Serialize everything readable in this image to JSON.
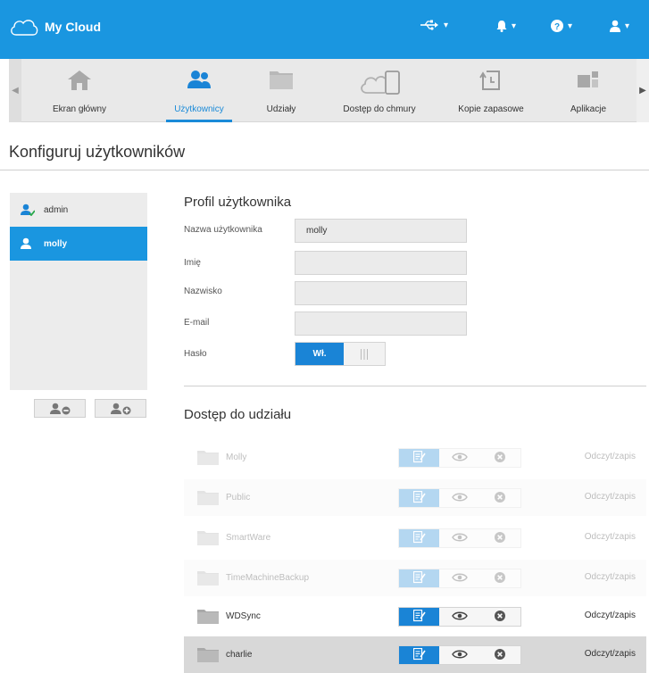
{
  "app": {
    "logo_text": "My Cloud"
  },
  "topbar": {
    "items": [
      {
        "icon": "usb-icon"
      },
      {
        "icon": "bell-icon"
      },
      {
        "icon": "help-icon"
      },
      {
        "icon": "user-icon"
      }
    ]
  },
  "nav": {
    "items": [
      {
        "label": "Ekran główny",
        "icon": "home-icon"
      },
      {
        "label": "Użytkownicy",
        "icon": "users-icon",
        "active": true
      },
      {
        "label": "Udziały",
        "icon": "folder-icon"
      },
      {
        "label": "Dostęp do chmury",
        "icon": "cloud-device-icon"
      },
      {
        "label": "Kopie zapasowe",
        "icon": "backup-icon"
      },
      {
        "label": "Aplikacje",
        "icon": "apps-icon"
      }
    ]
  },
  "page": {
    "title": "Konfiguruj użytkowników"
  },
  "users": [
    {
      "name": "admin"
    },
    {
      "name": "molly",
      "selected": true
    }
  ],
  "profile": {
    "title": "Profil użytkownika",
    "fields": {
      "username_label": "Nazwa użytkownika",
      "username_value": "molly",
      "first_name_label": "Imię",
      "first_name_value": "",
      "last_name_label": "Nazwisko",
      "last_name_value": "",
      "email_label": "E-mail",
      "email_value": "",
      "password_label": "Hasło",
      "password_toggle_on": "Wł."
    }
  },
  "shares": {
    "title": "Dostęp do udziału",
    "rows": [
      {
        "name": "Molly",
        "status": "Odczyt/zapis"
      },
      {
        "name": "Public",
        "status": "Odczyt/zapis"
      },
      {
        "name": "SmartWare",
        "status": "Odczyt/zapis"
      },
      {
        "name": "TimeMachineBackup",
        "status": "Odczyt/zapis"
      },
      {
        "name": "WDSync",
        "status": "Odczyt/zapis"
      },
      {
        "name": "charlie",
        "status": "Odczyt/zapis"
      }
    ]
  },
  "colors": {
    "accent": "#1a96e0",
    "toggle_on": "#1a84d6"
  }
}
